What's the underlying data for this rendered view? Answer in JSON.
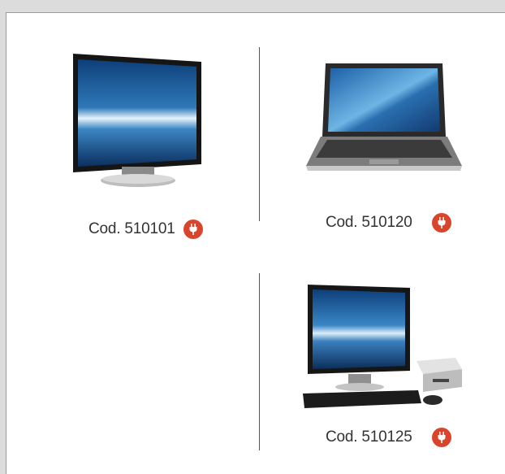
{
  "products": [
    {
      "code_label": "Cod. 510101",
      "image": "monitor",
      "icon": "plug-icon"
    },
    {
      "code_label": "Cod. 510120",
      "image": "laptop",
      "icon": "plug-icon"
    },
    {
      "code_label": "Cod. 510125",
      "image": "desktop-pc",
      "icon": "plug-icon"
    }
  ],
  "colors": {
    "badge": "#d9442c",
    "background": "#dcdcdc",
    "panel": "#ffffff",
    "divider": "#555555"
  }
}
